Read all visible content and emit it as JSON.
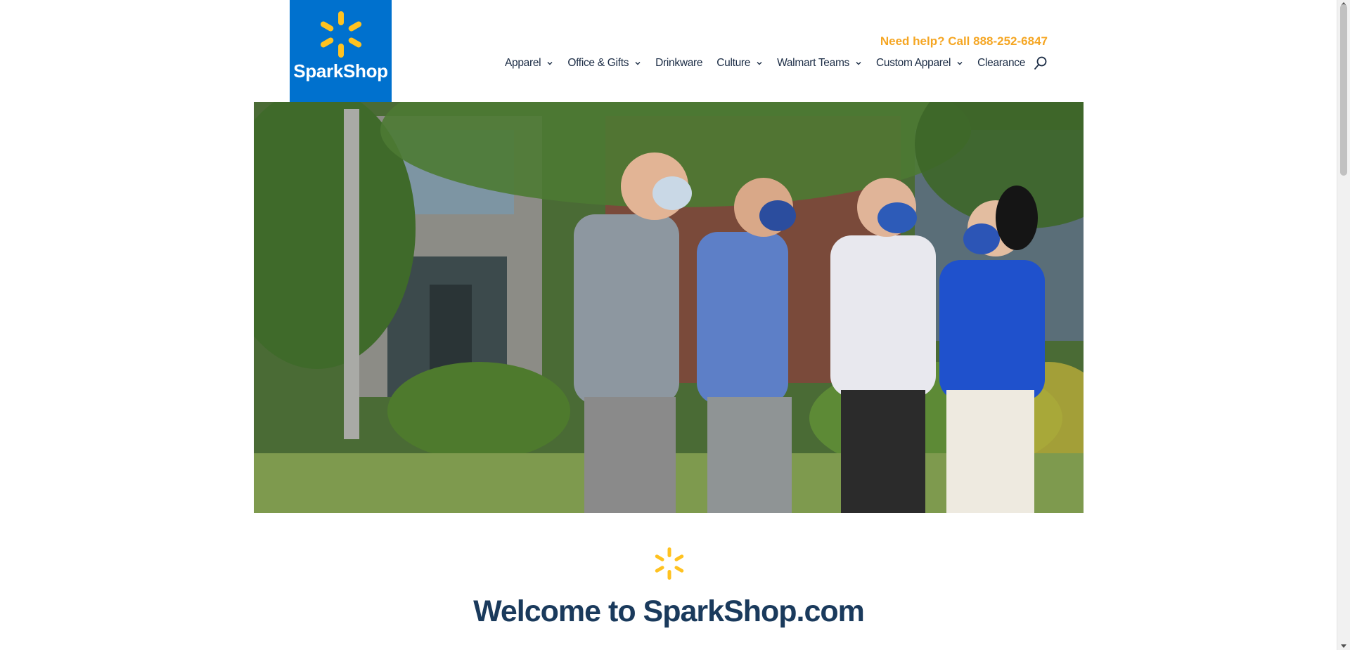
{
  "brand": {
    "logo_text": "SparkShop",
    "primary_color": "#0071ce",
    "spark_color": "#ffc220"
  },
  "header": {
    "help_prefix": "Need help? Call ",
    "help_phone": "888-252-6847"
  },
  "nav": {
    "items": [
      {
        "label": "Apparel",
        "has_dropdown": true
      },
      {
        "label": "Office & Gifts",
        "has_dropdown": true
      },
      {
        "label": "Drinkware",
        "has_dropdown": false
      },
      {
        "label": "Culture",
        "has_dropdown": true
      },
      {
        "label": "Walmart Teams",
        "has_dropdown": true
      },
      {
        "label": "Custom Apparel",
        "has_dropdown": true
      },
      {
        "label": "Clearance",
        "has_dropdown": false
      }
    ],
    "search_icon": "search-icon"
  },
  "main": {
    "welcome_title": "Welcome to SparkShop.com"
  }
}
